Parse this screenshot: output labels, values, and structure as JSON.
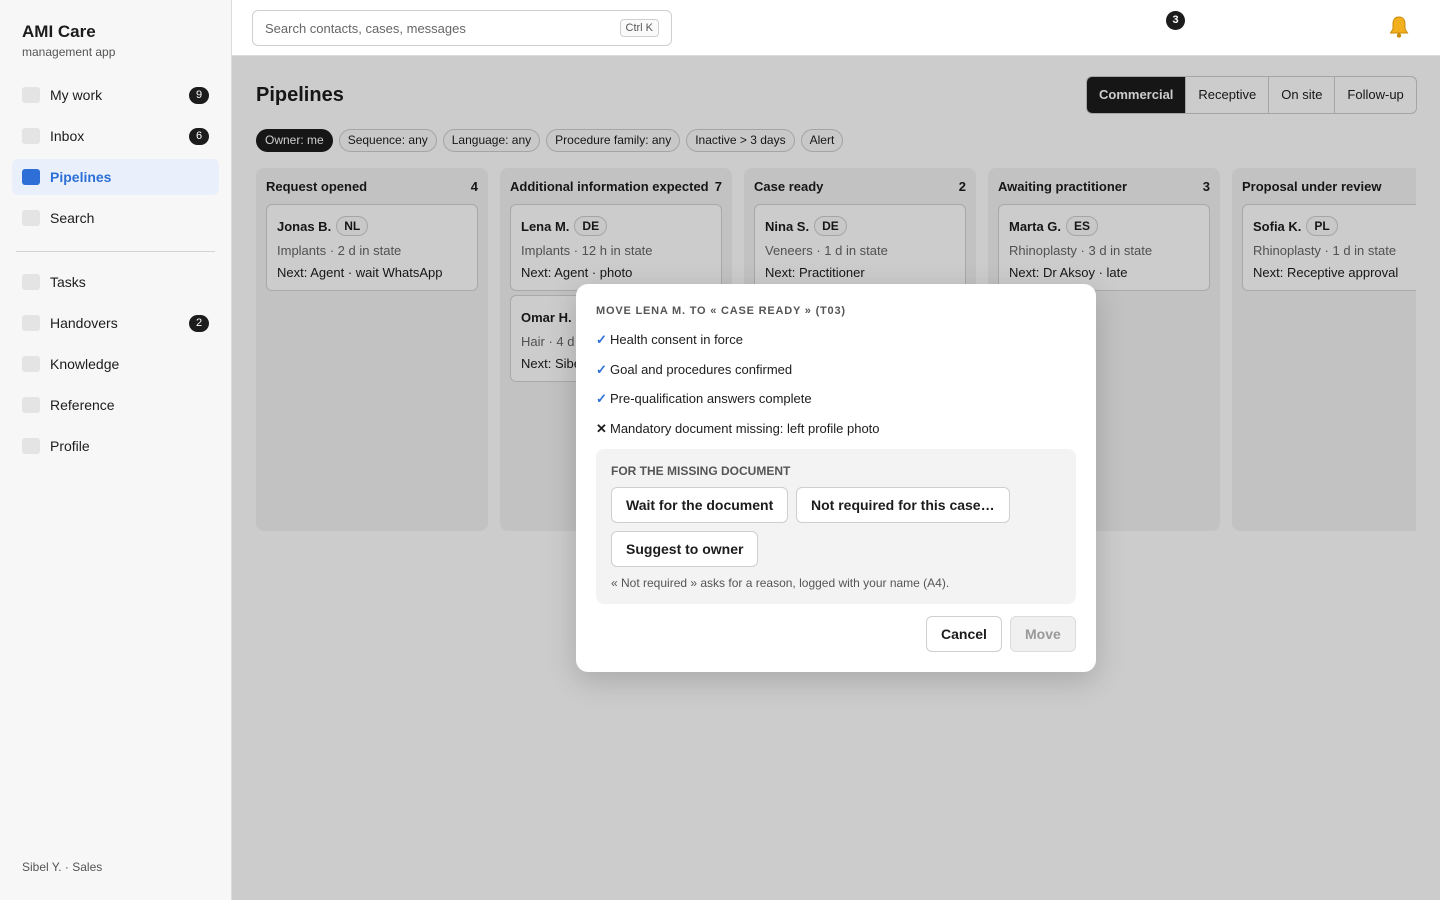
{
  "app": {
    "title": "AMI Care",
    "subtitle": "management app",
    "user": "Sibel Y. · Sales"
  },
  "sidebar": {
    "items": [
      {
        "label": "My work",
        "count": "9"
      },
      {
        "label": "Inbox",
        "count": "6"
      },
      {
        "label": "Pipelines",
        "count": ""
      },
      {
        "label": "Search",
        "count": ""
      },
      {
        "label": "Tasks",
        "count": ""
      },
      {
        "label": "Handovers",
        "count": "2"
      },
      {
        "label": "Knowledge",
        "count": ""
      },
      {
        "label": "Reference",
        "count": ""
      },
      {
        "label": "Profile",
        "count": ""
      }
    ],
    "active": "Pipelines"
  },
  "topbar": {
    "search_placeholder": "Search contacts, cases, messages",
    "shortcut": "Ctrl K",
    "notifications": "3"
  },
  "page": {
    "title": "Pipelines",
    "views": [
      "Commercial",
      "Receptive",
      "On site",
      "Follow-up"
    ],
    "active_view": "Commercial",
    "filters": [
      "Owner: me",
      "Sequence: any",
      "Language: any",
      "Procedure family: any",
      "Inactive > 3 days",
      "Alert"
    ],
    "active_filter": "Owner: me"
  },
  "board": {
    "columns": [
      {
        "title": "Request opened",
        "count": "4",
        "cards": [
          {
            "name": "Jonas B.",
            "lang": "NL",
            "meta": "Implants · 2 d in state",
            "next": "Next: Agent · wait WhatsApp"
          }
        ]
      },
      {
        "title": "Additional information expected",
        "count": "7",
        "cards": [
          {
            "name": "Lena M.",
            "lang": "DE",
            "meta": "Implants · 12 h in state",
            "next": "Next: Agent · photo"
          },
          {
            "name": "Omar H.",
            "lang": "",
            "meta": "Hair · 4 d",
            "next": "Next: Sibe"
          }
        ]
      },
      {
        "title": "Case ready",
        "count": "2",
        "cards": [
          {
            "name": "Nina S.",
            "lang": "DE",
            "meta": "Veneers · 1 d in state",
            "next": "Next: Practitioner"
          }
        ]
      },
      {
        "title": "Awaiting practitioner",
        "count": "3",
        "cards": [
          {
            "name": "Marta G.",
            "lang": "ES",
            "meta": "Rhinoplasty · 3 d in state",
            "next": "Next: Dr Aksoy · late"
          }
        ]
      },
      {
        "title": "Proposal under review",
        "count": "",
        "cards": [
          {
            "name": "Sofia K.",
            "lang": "PL",
            "meta": "Rhinoplasty · 1 d in state",
            "next": "Next: Receptive approval"
          }
        ]
      }
    ]
  },
  "modal": {
    "title": "MOVE LENA M. TO « CASE READY » (T03)",
    "checks": [
      {
        "mark": "✓",
        "status": "ok",
        "text": "Health consent in force"
      },
      {
        "mark": "✓",
        "status": "ok",
        "text": "Goal and procedures confirmed"
      },
      {
        "mark": "✓",
        "status": "ok",
        "text": "Pre-qualification answers complete"
      },
      {
        "mark": "✕",
        "status": "missing",
        "text": "Mandatory document missing: left profile photo"
      }
    ],
    "missing_heading": "FOR THE MISSING DOCUMENT",
    "options": [
      "Wait for the document",
      "Not required for this case…",
      "Suggest to owner"
    ],
    "note": "« Not required » asks for a reason, logged with your name (A4).",
    "cancel": "Cancel",
    "move": "Move"
  },
  "colors": {
    "accent": "#2d6fd6",
    "dark": "#1c1c1c",
    "column_bg": "#f3f3f3",
    "sidebar_bg": "#f7f7f7"
  },
  "icons": {
    "notifications": "bell-icon"
  }
}
